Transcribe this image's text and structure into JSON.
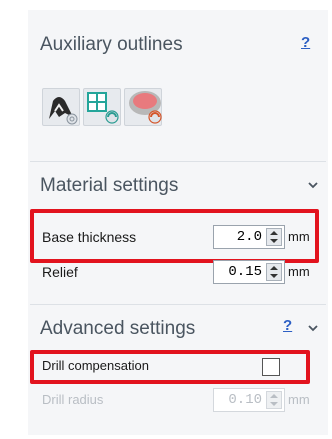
{
  "auxiliary": {
    "title": "Auxiliary outlines",
    "help": "?",
    "tools": [
      "outline-jaw-tool",
      "grid-outline-tool",
      "pad-outline-tool"
    ]
  },
  "material": {
    "title": "Material settings",
    "base_thickness_label": "Base thickness",
    "base_thickness_value": "2.0",
    "base_thickness_unit": "mm",
    "relief_label": "Relief",
    "relief_value": "0.15",
    "relief_unit": "mm"
  },
  "advanced": {
    "title": "Advanced settings",
    "help": "?",
    "drill_comp_label": "Drill compensation",
    "drill_radius_label": "Drill radius",
    "drill_radius_value": "0.10",
    "drill_radius_unit": "mm"
  },
  "colors": {
    "highlight": "#e2131e",
    "link": "#2c5fc4",
    "panel": "#f5f6f8"
  }
}
